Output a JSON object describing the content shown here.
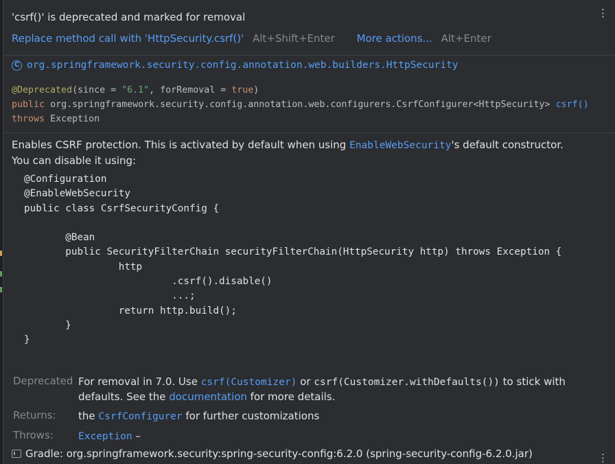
{
  "warning": {
    "title": "'csrf()' is deprecated and marked for removal",
    "fix_label": "Replace method call with 'HttpSecurity.csrf()'",
    "fix_shortcut": "Alt+Shift+Enter",
    "more_actions": "More actions...",
    "more_shortcut": "Alt+Enter"
  },
  "icons": {
    "menu": "more-vertical-icon",
    "class": "class-icon",
    "library": "library-icon"
  },
  "class_header": {
    "icon_glyph": "C",
    "name": "org.springframework.security.config.annotation.web.builders.HttpSecurity"
  },
  "signature": {
    "annotation": "@Deprecated",
    "open_paren": "(",
    "since_part": "since = ",
    "since_value": "\"6.1\"",
    "removal_part": ", forRemoval = ",
    "removal_value": "true",
    "close_paren": ")",
    "modifier": "public",
    "return_type": "org.springframework.security.config.annotation.web.configurers.CsrfConfigurer<HttpSecurity>",
    "method": "csrf()",
    "throws_kw": "throws",
    "exception": "Exception"
  },
  "description": {
    "text1": "Enables CSRF protection. This is activated by default when using ",
    "link": "EnableWebSecurity",
    "text2": "'s default constructor.",
    "text3": "You can disable it using:",
    "code": "@Configuration\n@EnableWebSecurity\npublic class CsrfSecurityConfig {\n\n       @Bean\n       public SecurityFilterChain securityFilterChain(HttpSecurity http) throws Exception {\n                http\n                         .csrf().disable()\n                         ...;\n                return http.build();\n       }\n}"
  },
  "tags": {
    "deprecated_label": "Deprecated",
    "deprecated_text1": "For removal in 7.0. Use ",
    "deprecated_link1": "csrf(Customizer)",
    "deprecated_text2": " or ",
    "deprecated_code": "csrf(Customizer.withDefaults())",
    "deprecated_text3": " to stick with defaults. See the ",
    "deprecated_link2": "documentation",
    "deprecated_text4": " for more details.",
    "returns_label": "Returns:",
    "returns_text1": "the ",
    "returns_link": "CsrfConfigurer",
    "returns_text2": " for further customizations",
    "throws_label": "Throws:",
    "throws_link": "Exception",
    "throws_text": " –"
  },
  "footer": {
    "library": "Gradle: org.springframework.security:spring-security-config:6.2.0 (spring-security-config-6.2.0.jar)"
  },
  "colors": {
    "background": "#2b2d30",
    "link": "#589df6",
    "keyword": "#cf8e6d",
    "annotation": "#b3ae60",
    "string": "#6aab73",
    "muted": "#86898f"
  }
}
